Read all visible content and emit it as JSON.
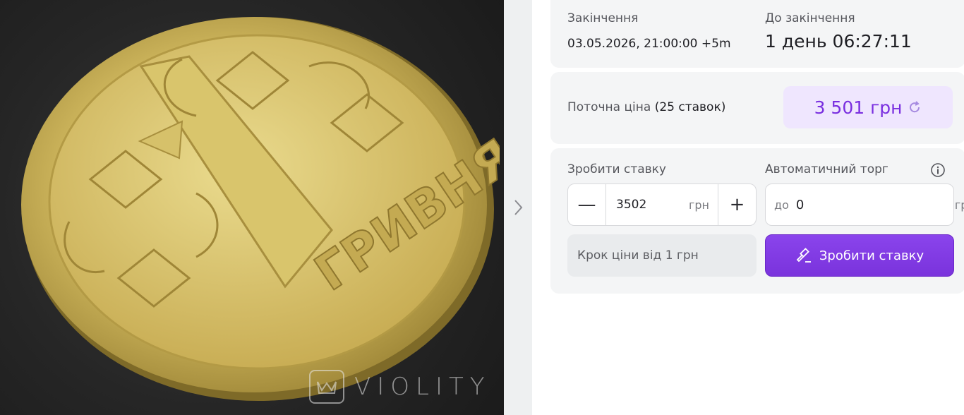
{
  "gallery": {
    "watermark": "VIOLITY",
    "coin_legend": "ГРИВНЯ"
  },
  "auction": {
    "end_label": "Закінчення",
    "end_value": "03.05.2026, 21:00:00 +5m",
    "remaining_label": "До закінчення",
    "remaining_value": "1 день 06:27:11",
    "current_price_label": "Поточна ціна",
    "bids_count": "(25 ставок)",
    "current_price": "3 501 грн"
  },
  "bid": {
    "make_bid_label": "Зробити ставку",
    "decrement": "—",
    "increment": "+",
    "amount": "3502",
    "unit": "грн",
    "auto_label": "Автоматичний торг",
    "auto_prefix": "до",
    "auto_value": "0",
    "auto_unit": "грн",
    "step_hint": "Крок ціни від 1 грн",
    "submit_label": "Зробити ставку"
  },
  "colors": {
    "accent": "#7a33dc",
    "price_chip_bg": "#efe6fe",
    "card_bg": "#f4f5f6"
  }
}
